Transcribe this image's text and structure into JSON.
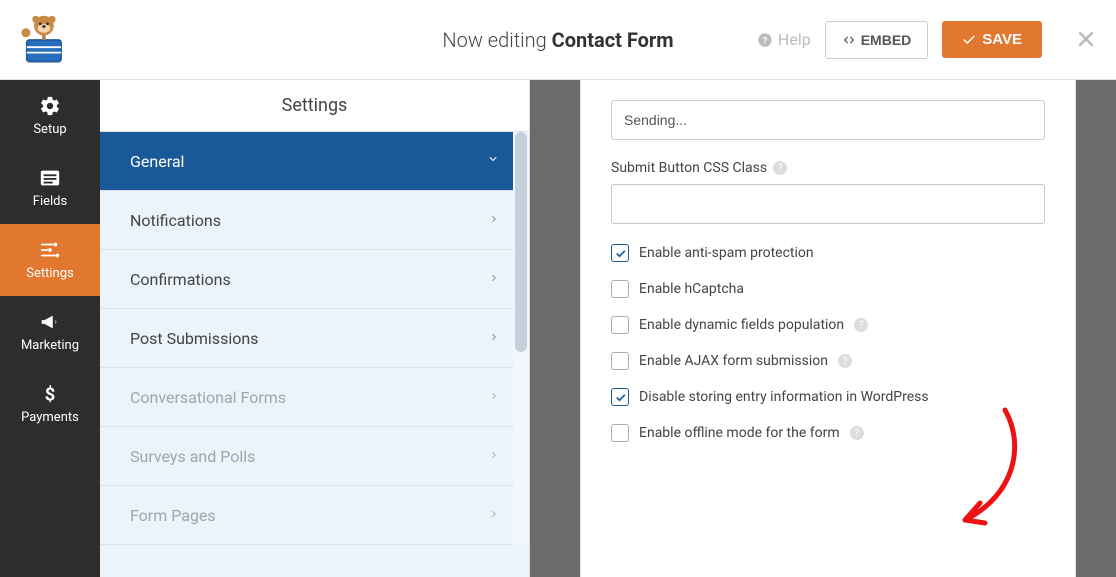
{
  "topbar": {
    "now_editing_prefix": "Now editing ",
    "form_name": "Contact Form",
    "help_label": "Help",
    "embed_label": "EMBED",
    "save_label": "SAVE"
  },
  "sidebar": {
    "items": [
      {
        "label": "Setup"
      },
      {
        "label": "Fields"
      },
      {
        "label": "Settings"
      },
      {
        "label": "Marketing"
      },
      {
        "label": "Payments"
      }
    ]
  },
  "settings_panel": {
    "title": "Settings",
    "items": [
      {
        "label": "General",
        "active": true
      },
      {
        "label": "Notifications"
      },
      {
        "label": "Confirmations"
      },
      {
        "label": "Post Submissions"
      },
      {
        "label": "Conversational Forms",
        "disabled": true
      },
      {
        "label": "Surveys and Polls",
        "disabled": true
      },
      {
        "label": "Form Pages",
        "disabled": true
      }
    ]
  },
  "form": {
    "sending_value": "Sending...",
    "css_class_label": "Submit Button CSS Class",
    "css_class_value": "",
    "checks": [
      {
        "label": "Enable anti-spam protection",
        "checked": true,
        "help": false
      },
      {
        "label": "Enable hCaptcha",
        "checked": false,
        "help": false
      },
      {
        "label": "Enable dynamic fields population",
        "checked": false,
        "help": true
      },
      {
        "label": "Enable AJAX form submission",
        "checked": false,
        "help": true
      },
      {
        "label": "Disable storing entry information in WordPress",
        "checked": true,
        "help": false
      },
      {
        "label": "Enable offline mode for the form",
        "checked": false,
        "help": true
      }
    ]
  }
}
